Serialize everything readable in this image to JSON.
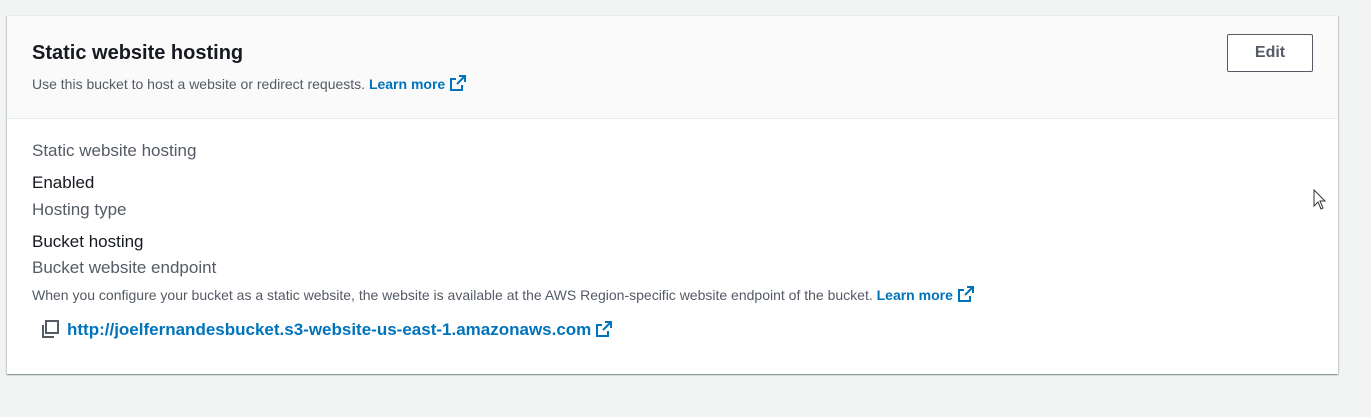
{
  "header": {
    "title": "Static website hosting",
    "description": "Use this bucket to host a website or redirect requests.",
    "learn_more": "Learn more",
    "edit_label": "Edit"
  },
  "fields": {
    "hosting_label": "Static website hosting",
    "hosting_value": "Enabled",
    "type_label": "Hosting type",
    "type_value": "Bucket hosting",
    "endpoint_label": "Bucket website endpoint",
    "endpoint_hint": "When you configure your bucket as a static website, the website is available at the AWS Region-specific website endpoint of the bucket.",
    "endpoint_learn_more": "Learn more",
    "endpoint_url": "http://joelfernandesbucket.s3-website-us-east-1.amazonaws.com"
  },
  "icons": {
    "external_link": "external-link-icon",
    "copy": "copy-icon",
    "cursor": "mouse-cursor-icon"
  },
  "colors": {
    "link": "#0073bb",
    "text": "#16191f",
    "secondary_text": "#545b64",
    "header_bg": "#fafafa",
    "page_bg": "#f2f3f3"
  }
}
